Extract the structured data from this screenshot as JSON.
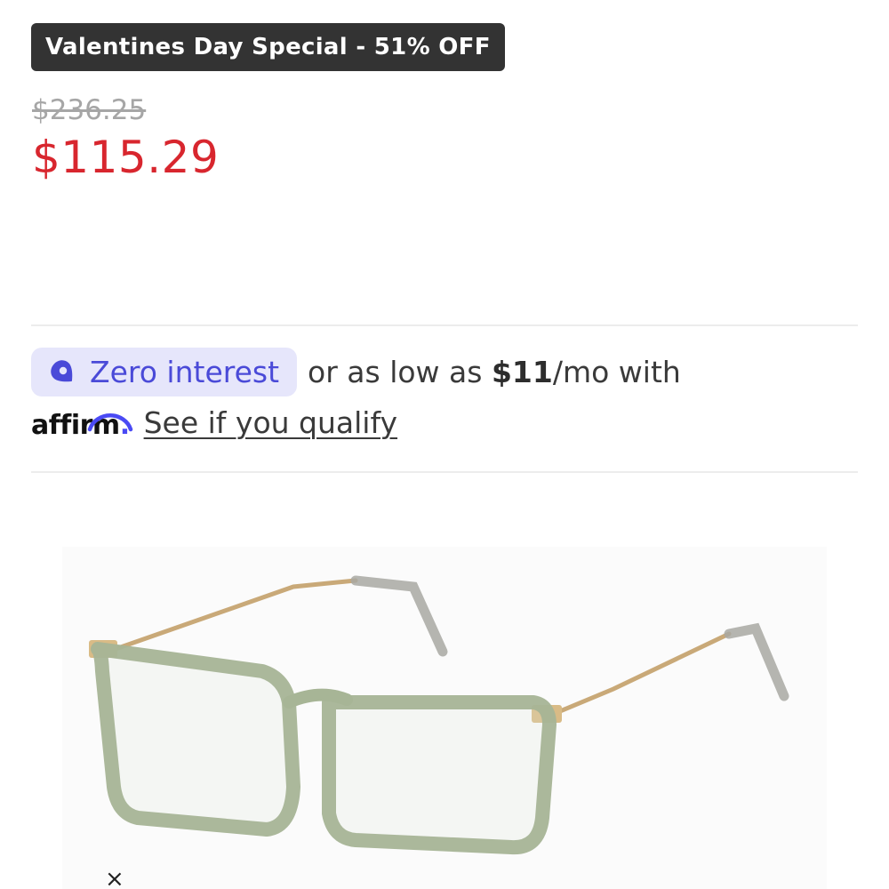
{
  "promo": {
    "badge_text": "Valentines Day Special - 51% OFF"
  },
  "pricing": {
    "original_price": "$236.25",
    "sale_price": "$115.29",
    "sale_color": "#d8262e"
  },
  "financing": {
    "pill_icon": "tag-icon",
    "pill_text": "Zero interest",
    "text_before": "or as low as",
    "monthly_amount": "$11",
    "text_after": "/mo with",
    "provider_logo": "affirm",
    "provider_dot": ".",
    "qualify_link": "See if you qualify",
    "accent_color": "#4a4ad8"
  },
  "product": {
    "image_icon": "eyeglasses-image",
    "close_symbol": "×"
  }
}
